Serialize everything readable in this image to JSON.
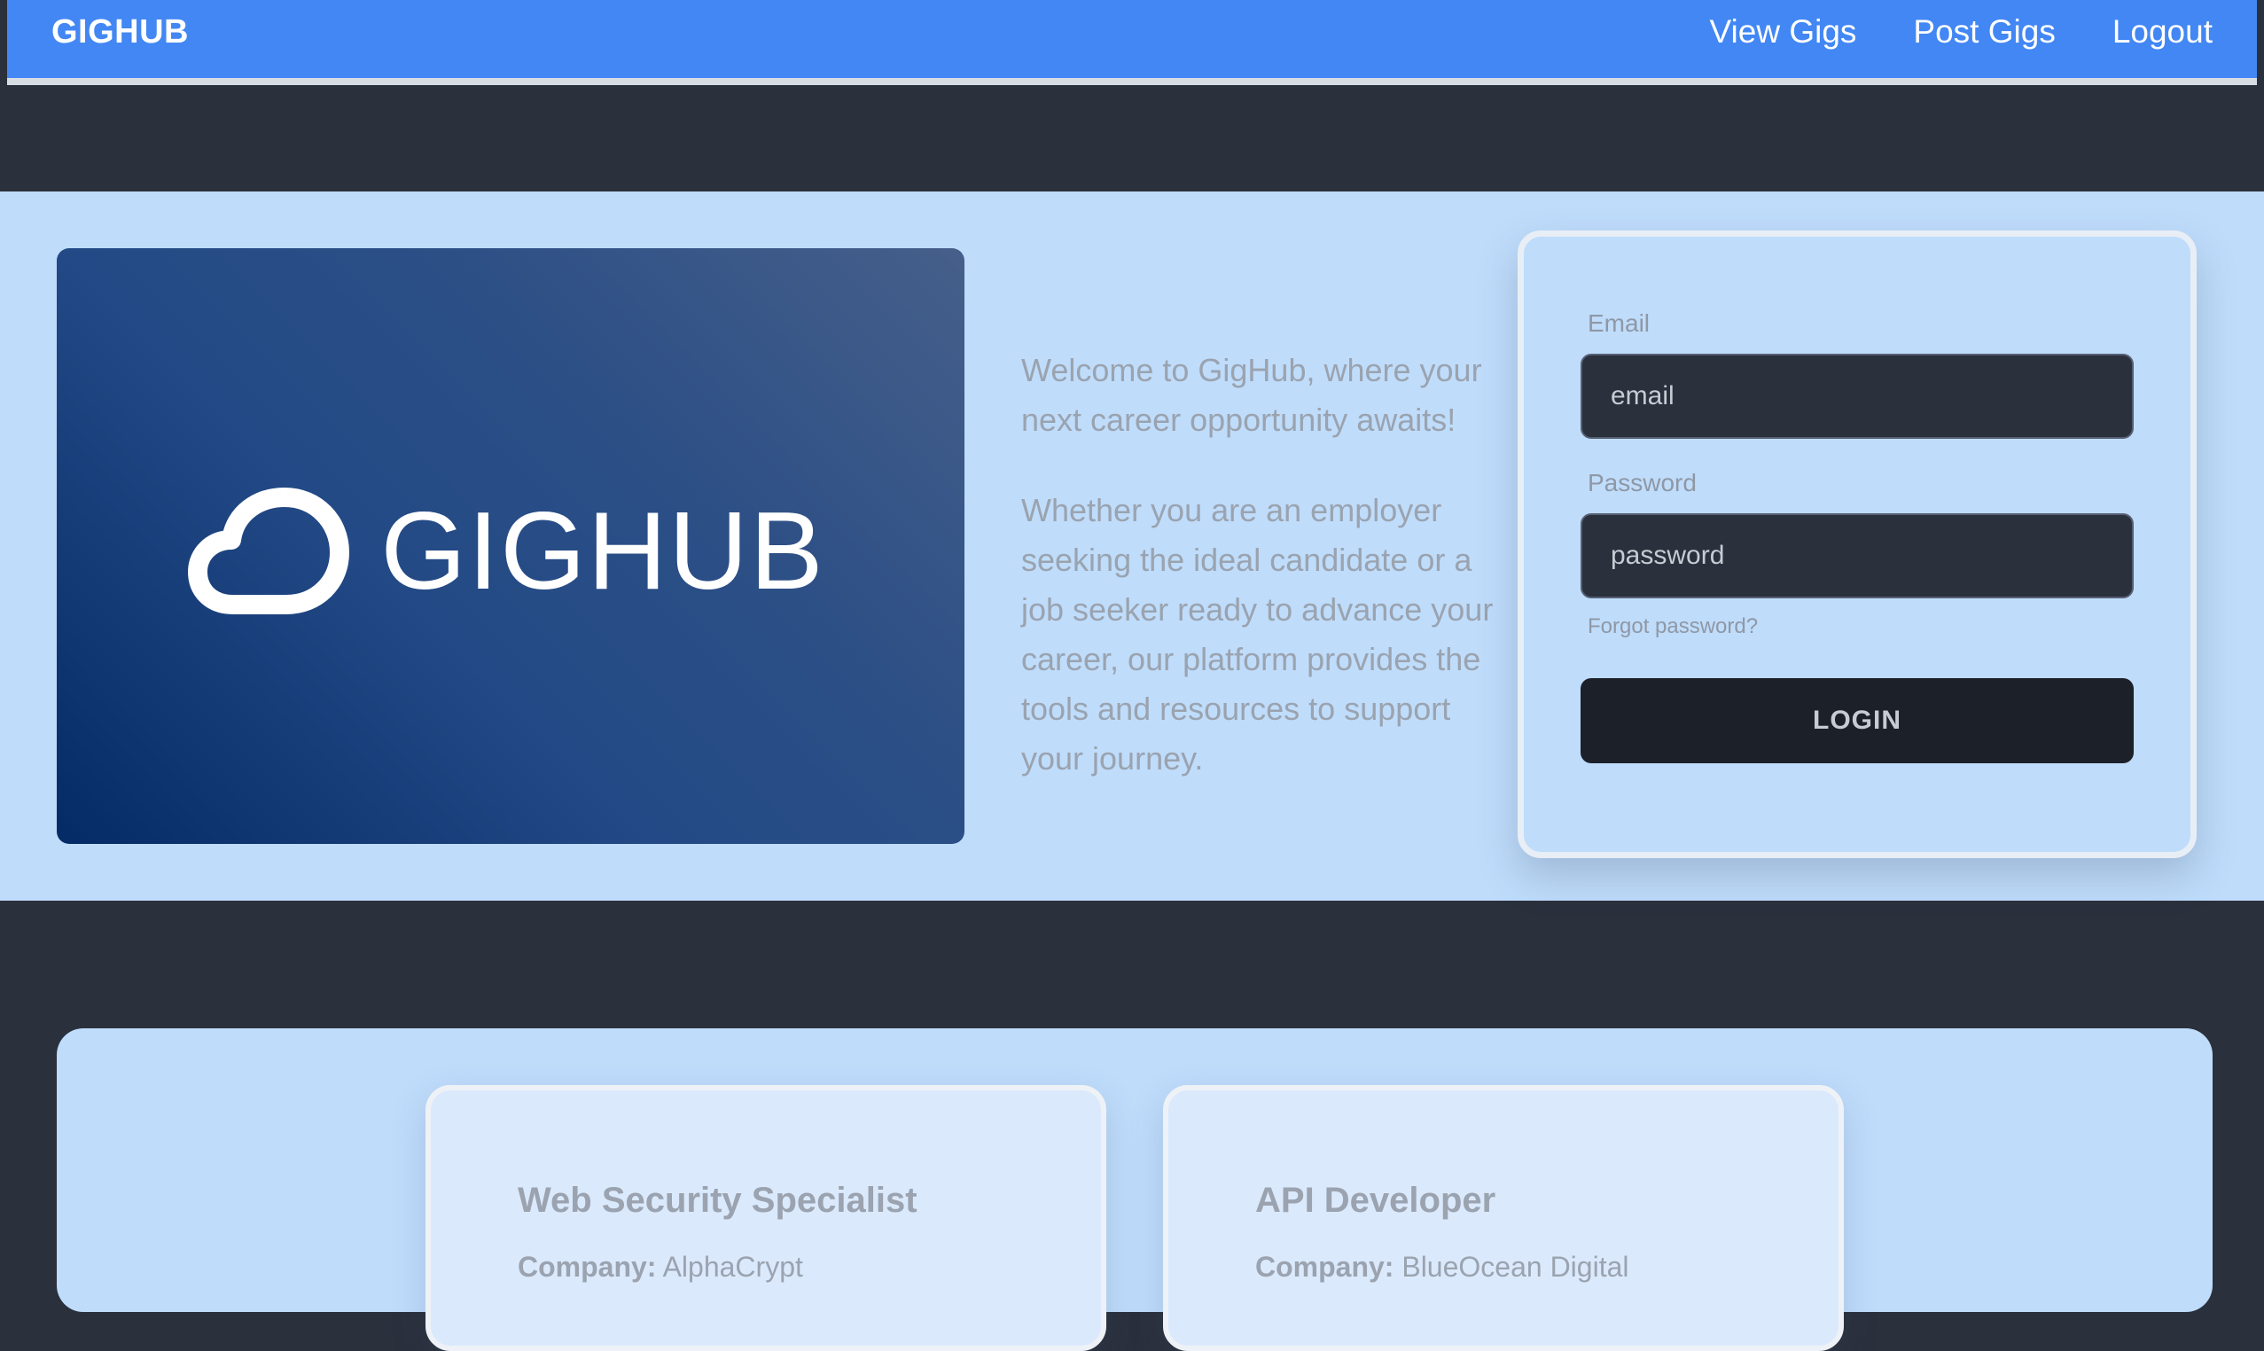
{
  "navbar": {
    "brand": "GIGHUB",
    "links": [
      "View Gigs",
      "Post Gigs",
      "Logout"
    ],
    "color": "#4287f4"
  },
  "hero": {
    "logo": {
      "text": "GIGHUB",
      "icon": "cloud-icon"
    },
    "intro": {
      "p1": "Welcome to GigHub, where your next career opportunity awaits!",
      "p2": "Whether you are an employer seeking the ideal candidate or a job seeker ready to advance your career, our platform provides the tools and resources to support your journey."
    }
  },
  "login": {
    "email_label": "Email",
    "email_placeholder": "email",
    "password_label": "Password",
    "password_placeholder": "password",
    "forgot_label": "Forgot password?",
    "button_label": "LOGIN"
  },
  "gigs": [
    {
      "title": "Web Security Specialist",
      "company_label": "Company:",
      "company": "AlphaCrypt"
    },
    {
      "title": "API Developer",
      "company_label": "Company:",
      "company": "BlueOcean Digital"
    }
  ]
}
